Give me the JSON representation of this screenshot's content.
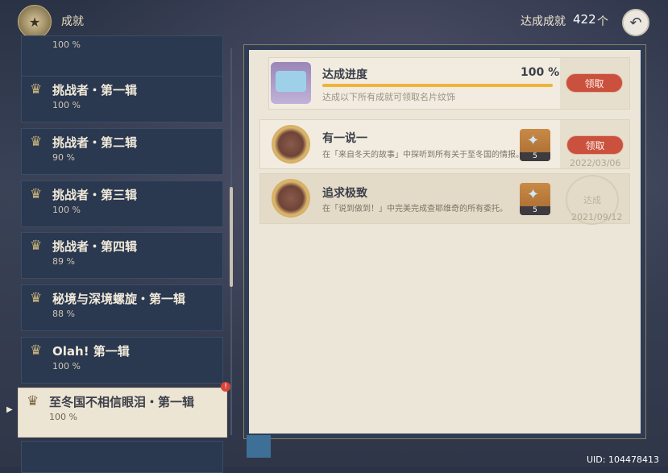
{
  "header": {
    "title": "成就",
    "count_label": "达成成就",
    "count_value": "422",
    "count_unit": "个",
    "back_icon": "back-arrow-icon"
  },
  "categories": [
    {
      "name": "",
      "pct": "100 %"
    },
    {
      "name": "挑战者・第一辑",
      "pct": "100 %"
    },
    {
      "name": "挑战者・第二辑",
      "pct": "90 %"
    },
    {
      "name": "挑战者・第三辑",
      "pct": "100 %"
    },
    {
      "name": "挑战者・第四辑",
      "pct": "89 %"
    },
    {
      "name": "秘境与深境螺旋・第一辑",
      "pct": "88 %"
    },
    {
      "name": "Olah! 第一辑",
      "pct": "100 %"
    },
    {
      "name": "至冬国不相信眼泪・第一辑",
      "pct": "100 %"
    }
  ],
  "selected_badge": "!",
  "progress": {
    "title": "达成进度",
    "pct_text": "100 %",
    "fraction": 1.0,
    "desc": "达成以下所有成就可领取名片纹饰",
    "claim_label": "领取"
  },
  "achievements": [
    {
      "name": "有一说一",
      "desc": "在「来自冬天的故事」中探听到所有关于至冬国的情报。",
      "reward_qty": "5",
      "claim_label": "领取",
      "date": "2022/03/06"
    },
    {
      "name": "追求极致",
      "desc": "在「说到做到！」中完美完成查耶维奇的所有委托。",
      "reward_qty": "5",
      "stamp": "达成",
      "date": "2021/09/12"
    }
  ],
  "uid": "UID: 104478413",
  "colors": {
    "accent": "#f0b33a",
    "claim": "#c9513e",
    "panel": "#ece6d8"
  }
}
